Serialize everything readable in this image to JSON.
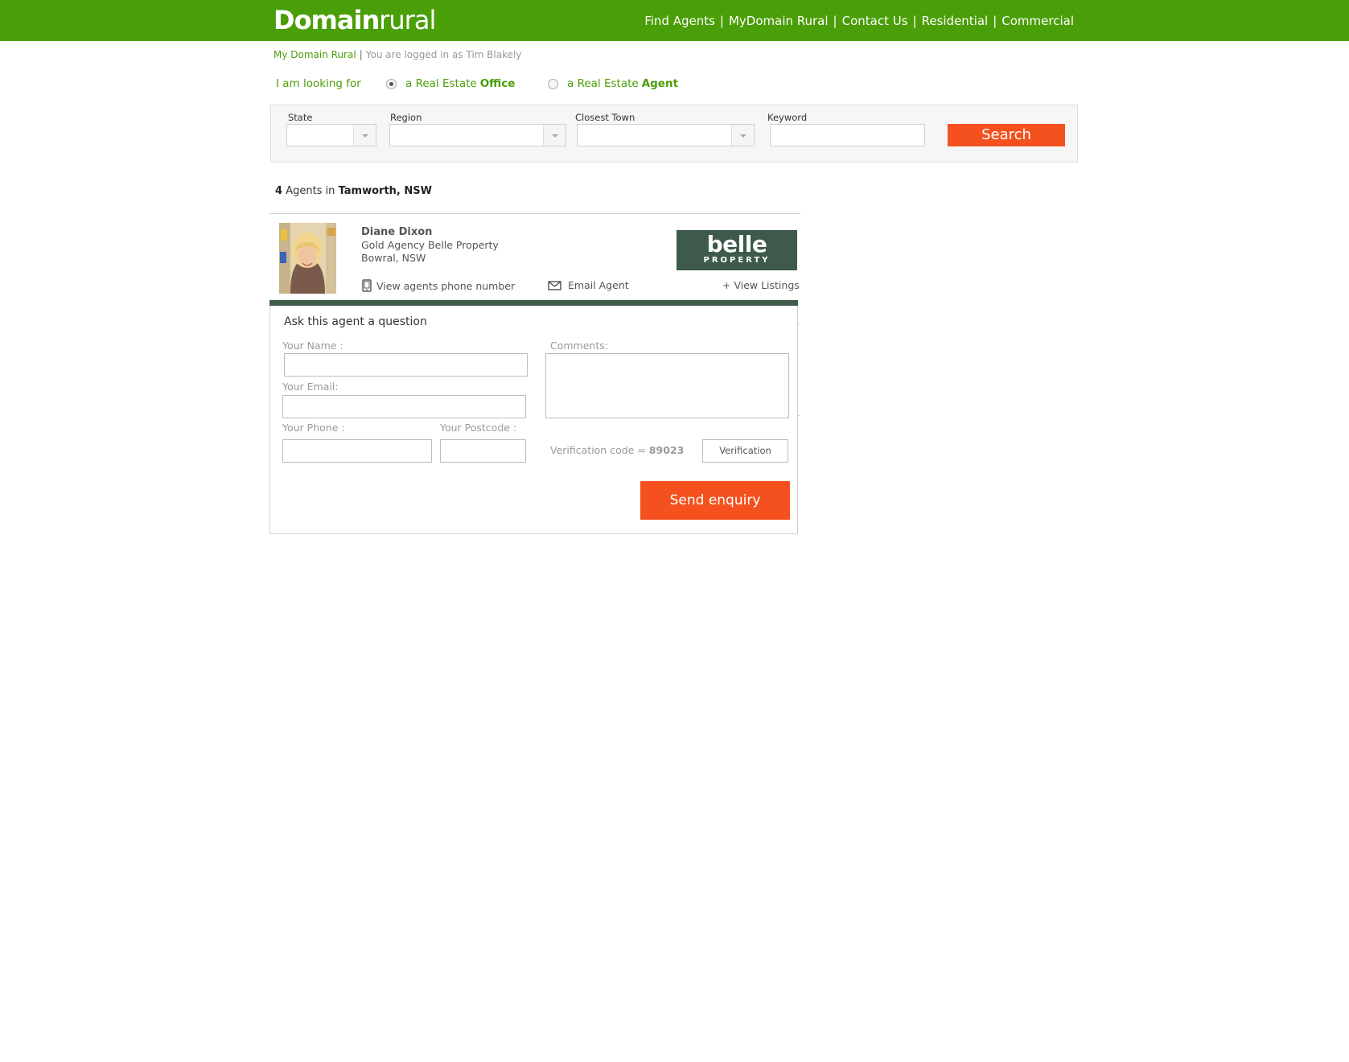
{
  "header": {
    "logo_bold": "Domain",
    "logo_light": "rural",
    "nav": [
      {
        "label": "Find Agents"
      },
      {
        "label": "MyDomain Rural"
      },
      {
        "label": "Contact Us"
      },
      {
        "label": "Residential"
      },
      {
        "label": "Commercial"
      }
    ],
    "separator": "|"
  },
  "breadcrumb": {
    "link": "My Domain Rural",
    "separator": "|",
    "login_text": "You are logged in as Tim Blakely"
  },
  "looking_for": {
    "label": "I am looking for",
    "options": [
      {
        "prefix": "a Real Estate",
        "emphasis": "Office",
        "checked": true
      },
      {
        "prefix": "a Real Estate",
        "emphasis": "Agent",
        "checked": false
      }
    ]
  },
  "search": {
    "state_label": "State",
    "region_label": "Region",
    "town_label": "Closest Town",
    "keyword_label": "Keyword",
    "state_value": "",
    "region_value": "",
    "town_value": "",
    "keyword_value": "",
    "button_label": "Search"
  },
  "results": {
    "count": "4",
    "text": "Agents in",
    "location": "Tamworth, NSW"
  },
  "agent": {
    "name": "Diane Dixon",
    "agency": "Gold Agency Belle Property",
    "location": "Bowral, NSW",
    "brand_name": "belle",
    "brand_sub": "PROPERTY",
    "phone_link": "View agents phone number",
    "email_link": "Email Agent",
    "listings_link": "+ View Listings"
  },
  "enquiry": {
    "title": "Ask this agent a question",
    "name_label": "Your Name :",
    "email_label": "Your Email:",
    "phone_label": "Your Phone :",
    "postcode_label": "Your Postcode :",
    "comments_label": "Comments:",
    "verification_text": "Verification code =",
    "verification_code": "89023",
    "verification_placeholder": "Verification",
    "send_label": "Send enquiry"
  },
  "colors": {
    "brand_green": "#4a9e07",
    "accent_orange": "#f4511e",
    "belle_green": "#3d5a4a"
  }
}
